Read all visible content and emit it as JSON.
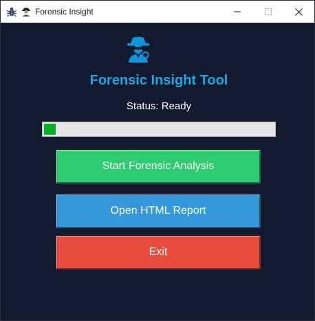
{
  "window": {
    "title": "Forensic Insight",
    "app_icon": "bug-icon",
    "secondary_icon": "detective-icon",
    "controls": [
      "minimize",
      "maximize",
      "close"
    ]
  },
  "header": {
    "icon": "detective-icon",
    "title": "Forensic Insight Tool"
  },
  "status": {
    "text": "Status: Ready"
  },
  "progress": {
    "fraction": 0.05
  },
  "buttons": {
    "start_label": "Start Forensic Analysis",
    "report_label": "Open HTML Report",
    "exit_label": "Exit"
  },
  "colors": {
    "background": "#111a2e",
    "title": "#1ea7e4",
    "progress_fill": "#06b025",
    "start_button": "#2ecc71",
    "report_button": "#3498db",
    "exit_button": "#e74c3c"
  }
}
